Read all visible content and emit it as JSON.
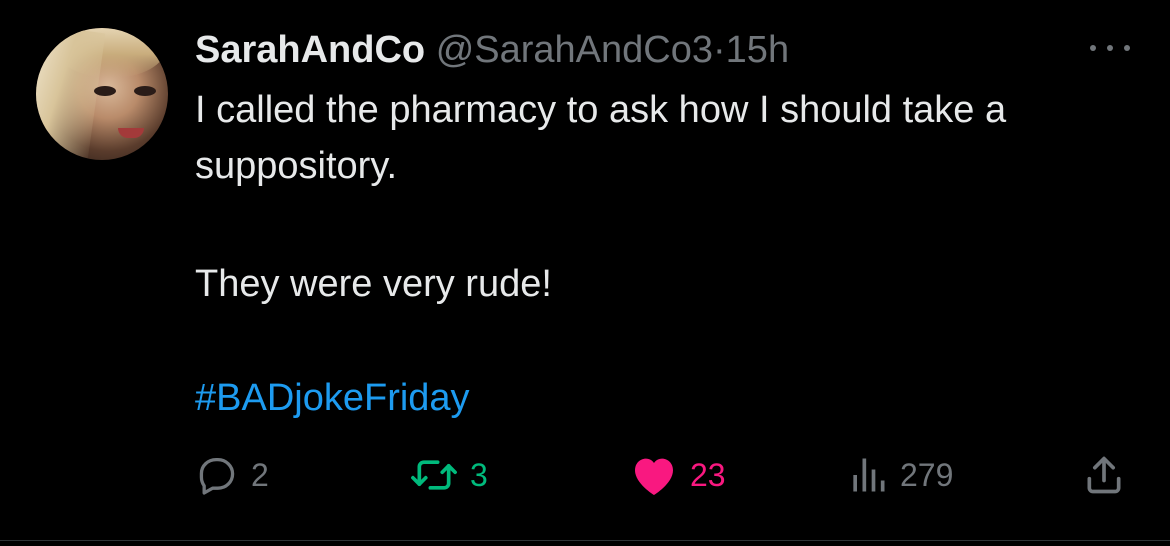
{
  "tweet": {
    "author_name": "SarahAndCo",
    "author_handle": "@SarahAndCo3",
    "separator": "·",
    "time": "15h",
    "text_line1": "I called the pharmacy to ask how I should take a suppository.",
    "text_line2": "They were very rude!",
    "hashtag": "#BADjokeFriday"
  },
  "actions": {
    "replies": "2",
    "retweets": "3",
    "likes": "23",
    "views": "279"
  },
  "icons": {
    "more": "more-icon",
    "reply": "reply-icon",
    "retweet": "retweet-icon",
    "like": "heart-icon",
    "views": "views-icon",
    "share": "share-icon"
  },
  "colors": {
    "background": "#000000",
    "text": "#e7e9ea",
    "muted": "#71767b",
    "link": "#1d9bf0",
    "retweet": "#00ba7c",
    "like": "#f91880"
  }
}
